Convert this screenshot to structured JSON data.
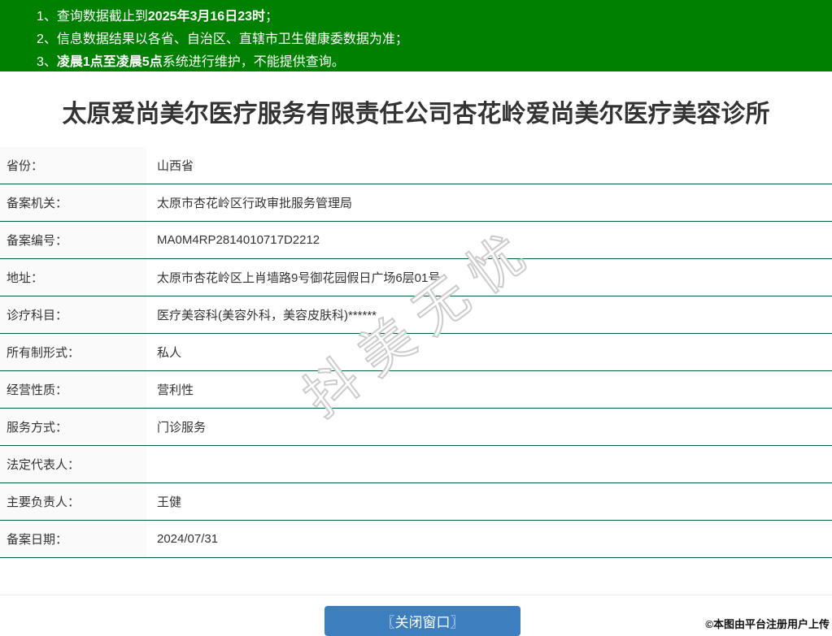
{
  "colors": {
    "notice_bar_bg": "#008000",
    "row_divider": "#006038",
    "label_column_bg": "#fafafa",
    "close_button_bg": "#3d7ebf",
    "text": "#333333"
  },
  "notice": {
    "lines": [
      {
        "pre": "1、查询数据截止到",
        "bold": "2025年3月16日23时",
        "post": "；"
      },
      {
        "pre": "2、信息数据结果以各省、自治区、直辖市卫生健康委数据为准；",
        "bold": "",
        "post": ""
      },
      {
        "pre": "3、",
        "bold": "凌晨1点至凌晨5点",
        "post": "系统进行维护，不能提供查询。"
      }
    ]
  },
  "page_title": "太原爱尚美尔医疗服务有限责任公司杏花岭爱尚美尔医疗美容诊所",
  "table": {
    "rows": [
      {
        "label": "省份：",
        "value": "山西省"
      },
      {
        "label": "备案机关：",
        "value": "太原市杏花岭区行政审批服务管理局"
      },
      {
        "label": "备案编号：",
        "value": "MA0M4RP2814010717D2212"
      },
      {
        "label": "地址：",
        "value": "太原市杏花岭区上肖墙路9号御花园假日广场6层01号"
      },
      {
        "label": "诊疗科目：",
        "value": "医疗美容科(美容外科，美容皮肤科)******"
      },
      {
        "label": "所有制形式：",
        "value": "私人"
      },
      {
        "label": "经营性质：",
        "value": "营利性"
      },
      {
        "label": "服务方式：",
        "value": "门诊服务"
      },
      {
        "label": "法定代表人：",
        "value": ""
      },
      {
        "label": "主要负责人：",
        "value": "王健"
      },
      {
        "label": "备案日期：",
        "value": "2024/07/31"
      }
    ]
  },
  "watermark_text": "抖美无忧",
  "close_button_label": "〖关闭窗口〗",
  "copyright_text": "©本图由平台注册用户上传"
}
